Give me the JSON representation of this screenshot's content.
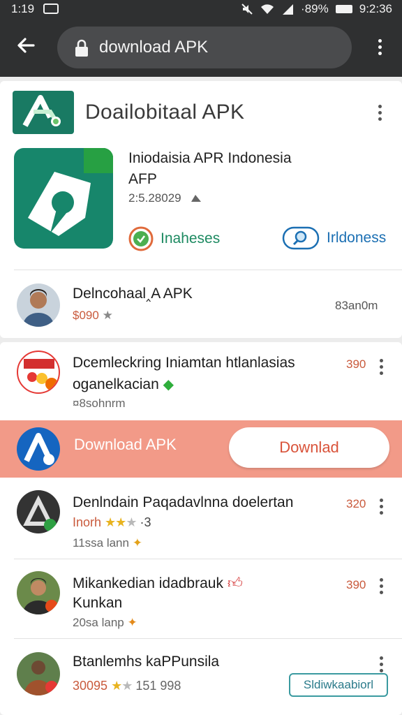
{
  "status_bar": {
    "time": "1:19",
    "battery": "·89%",
    "clock_right": "9:2:36"
  },
  "url_bar": {
    "back_icon": "arrow-left-icon",
    "url": "download APK",
    "lock_icon": "lock-icon",
    "menu_icon": "more-vert-icon"
  },
  "header": {
    "title": "Doailobitaal APK"
  },
  "app": {
    "title_line1": "Iniodaisia APR Indonesia",
    "title_line2": "AFP",
    "version": "2:5.28029",
    "chip1_label": "Inaheses",
    "chip2_label": "Irldoness"
  },
  "featured": {
    "name": "Delncohaal‸A APK",
    "price": "$090",
    "meta": "83an0m"
  },
  "list": [
    {
      "name": "Dcemleckring Iniamtan htlanlasias",
      "name2": "oganelkacian",
      "sub": "¤8sohnrm",
      "count": "390"
    },
    {
      "name": "Denlndain Paqadavlnna doelertan",
      "rating_prefix": "Inorh",
      "rating_suffix": "·3",
      "sub": "11ssa lann",
      "count": "320"
    },
    {
      "name": "Mikankedian idadbrauk",
      "name2": "Kunkan",
      "sub": "20sa lanp",
      "count": "390"
    },
    {
      "name": "Btanlemhs kaPPunsila",
      "price": "30095",
      "meta": "151 998",
      "action": "Sldiwkaabiorl"
    }
  ],
  "promo": {
    "label": "Download APK",
    "button": "Downlad"
  },
  "colors": {
    "brand_green": "#17866b",
    "accent_red": "#d9533a",
    "promo_bg": "#f29a88",
    "toolbar": "#2f3031"
  }
}
